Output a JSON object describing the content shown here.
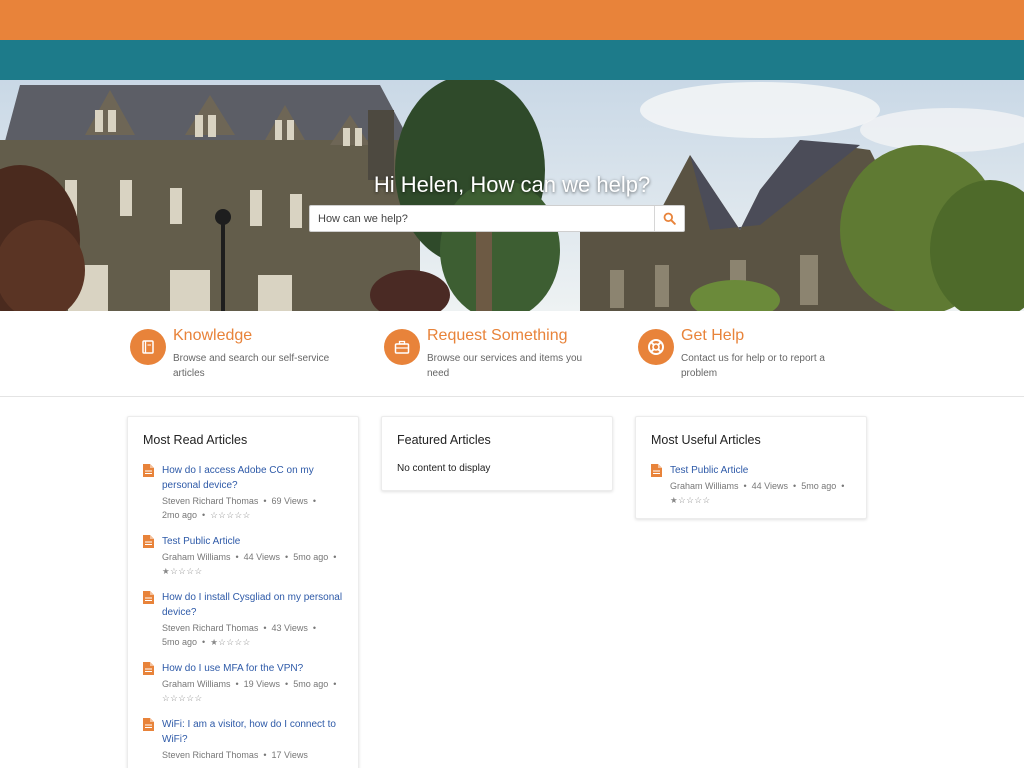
{
  "hero": {
    "greeting": "Hi Helen, How can we help?",
    "search_placeholder": "How can we help?"
  },
  "quick_links": [
    {
      "title": "Knowledge",
      "desc": "Browse and search our self-service articles",
      "icon": "book-icon"
    },
    {
      "title": "Request Something",
      "desc": "Browse our services and items you need",
      "icon": "briefcase-icon"
    },
    {
      "title": "Get Help",
      "desc": "Contact us for help or to report a problem",
      "icon": "lifebuoy-icon"
    }
  ],
  "most_read": {
    "title": "Most Read Articles",
    "articles": [
      {
        "title": "How do I access Adobe CC on my personal device?",
        "author": "Steven Richard Thomas",
        "views": "69 Views",
        "age": "2mo ago",
        "stars": "☆☆☆☆☆"
      },
      {
        "title": "Test Public Article",
        "author": "Graham Williams",
        "views": "44 Views",
        "age": "5mo ago",
        "stars": "★☆☆☆☆"
      },
      {
        "title": "How do I install Cysgliad on my personal device?",
        "author": "Steven Richard Thomas",
        "views": "43 Views",
        "age": "5mo ago",
        "stars": "★☆☆☆☆"
      },
      {
        "title": "How do I use MFA for the VPN?",
        "author": "Graham Williams",
        "views": "19 Views",
        "age": "5mo ago",
        "stars": "☆☆☆☆☆"
      },
      {
        "title": "WiFi: I am a visitor, how do I connect to WiFi?",
        "author": "Steven Richard Thomas",
        "views": "17 Views",
        "age": "",
        "stars": ""
      }
    ]
  },
  "featured": {
    "title": "Featured Articles",
    "empty": "No content to display"
  },
  "most_useful": {
    "title": "Most Useful Articles",
    "articles": [
      {
        "title": "Test Public Article",
        "author": "Graham Williams",
        "views": "44 Views",
        "age": "5mo ago",
        "stars": "★☆☆☆☆"
      }
    ]
  },
  "colors": {
    "accent": "#e8833a",
    "brand_teal": "#1d7b8a",
    "link": "#2e5aa8"
  }
}
